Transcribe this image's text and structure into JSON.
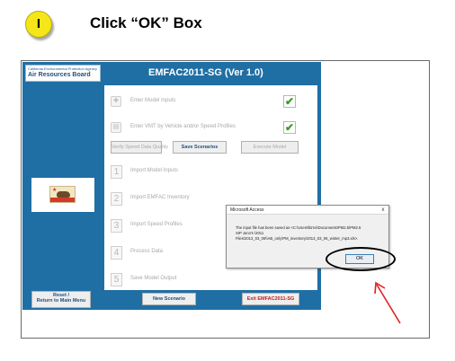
{
  "step": {
    "badge": "I",
    "instruction": "Click “OK” Box"
  },
  "app": {
    "title": "EMFAC2011-SG (Ver 1.0)",
    "logo_top": "California Environmental Protection Agency",
    "logo_main": "Air Resources Board",
    "rows": [
      {
        "icon": "pin-icon",
        "label": "Enter Model Inputs",
        "checked": true
      },
      {
        "icon": "document-icon",
        "label": "Enter VMT by Vehicle and/or Speed Profiles",
        "checked": true
      }
    ],
    "actions": {
      "verify": "Verify Speed Data Quality",
      "save": "Save Scenarios",
      "execute": "Execute Model"
    },
    "steps": [
      {
        "num": "1",
        "label": "Import Model Inputs"
      },
      {
        "num": "2",
        "label": "Import EMFAC Inventory"
      },
      {
        "num": "3",
        "label": "Import Speed Profiles"
      },
      {
        "num": "4",
        "label": "Process Data"
      },
      {
        "num": "5",
        "label": "Save Model Output"
      }
    ],
    "bottom": {
      "reset_line1": "Reset /",
      "reset_line2": "Return to Main Menu",
      "new_scenario": "New Scenario",
      "exit": "Exit EMFAC2011-SG"
    }
  },
  "dialog": {
    "title": "Microsoft Access",
    "close": "x",
    "lines": [
      "The input file has been saved as <C:\\Users\\ltirroi\\Documents\\PM2.5\\PM2.5",
      "SIP Juno's \\2011",
      "Files\\2013_03_06\\\\AB_only\\PM_inventory\\2013_03_06_winter_mp3.xls>."
    ],
    "ok_label": "OK"
  },
  "colors": {
    "accent": "#1f6fa5",
    "check": "#3e9a1f",
    "arrow": "#e02020",
    "exit": "#c0201a"
  }
}
